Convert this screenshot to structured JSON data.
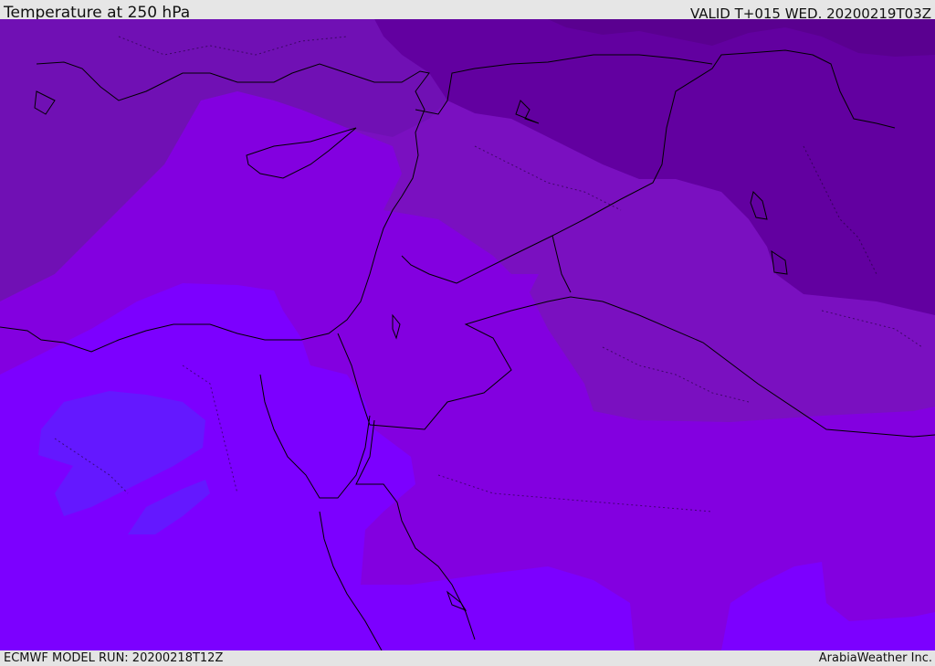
{
  "header": {
    "title": "Temperature at 250 hPa",
    "valid": "VALID T+015 WED. 20200219T03Z"
  },
  "footer": {
    "model_run": "ECMWF MODEL RUN: 20200218T12Z",
    "credit": "ArabiaWeather Inc."
  },
  "map": {
    "field": "Temperature",
    "level": "250 hPa",
    "colors": {
      "darkest": "#5e0096",
      "dark": "#6a00a8",
      "mid": "#7a0cba",
      "bright": "#8800e2",
      "brightest": "#7c00ff",
      "cool_patch": "#6414ff",
      "coast": "#000000"
    }
  }
}
